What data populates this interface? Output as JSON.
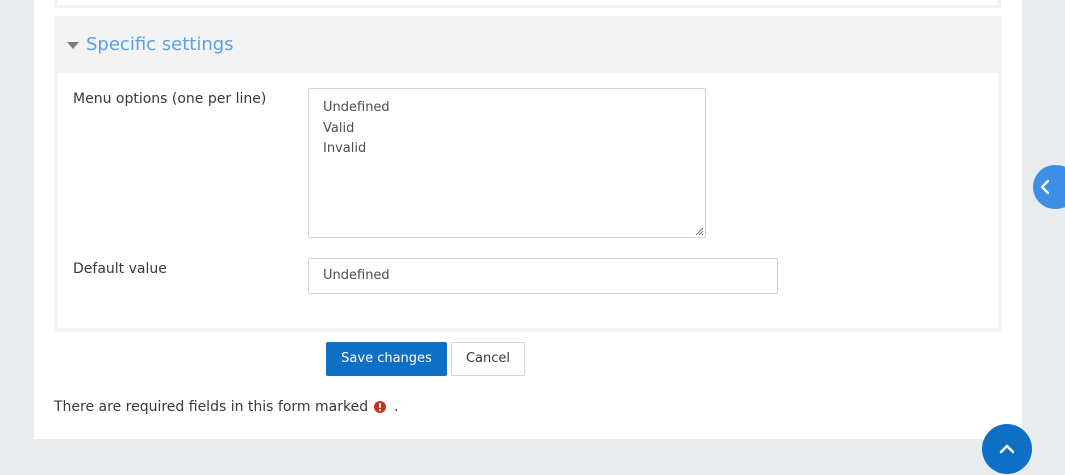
{
  "section": {
    "title": "Specific settings",
    "caret_icon": "caret-down-icon"
  },
  "menu_options": {
    "label": "Menu options (one per line)",
    "lines": [
      "Undefined",
      "Valid",
      "Invalid"
    ]
  },
  "default_value": {
    "label": "Default value",
    "value": "Undefined"
  },
  "buttons": {
    "save_label": "Save changes",
    "cancel_label": "Cancel"
  },
  "required_note": {
    "text": "There are required fields in this form marked",
    "suffix": ".",
    "icon": "required-exclamation-icon",
    "icon_color": "#ca3120"
  },
  "floating": {
    "drawer_icon": "chevron-left-icon",
    "back_to_top_icon": "chevron-up-icon"
  },
  "colors": {
    "accent": "#0f6fc5",
    "section_title": "#5aa1e3"
  }
}
